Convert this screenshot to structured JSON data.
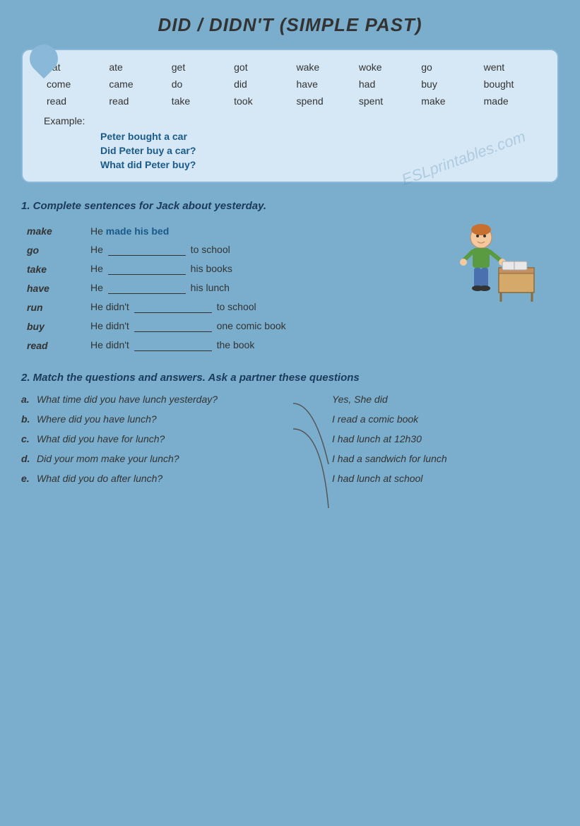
{
  "title": "DID / DIDN'T (SIMPLE PAST)",
  "vocab": {
    "pairs": [
      {
        "base": "eat",
        "past": "ate"
      },
      {
        "base": "get",
        "past": "got"
      },
      {
        "base": "wake",
        "past": "woke"
      },
      {
        "base": "go",
        "past": "went"
      },
      {
        "base": "come",
        "past": "came"
      },
      {
        "base": "do",
        "past": "did"
      },
      {
        "base": "have",
        "past": "had"
      },
      {
        "base": "buy",
        "past": "bought"
      },
      {
        "base": "read",
        "past": "read"
      },
      {
        "base": "take",
        "past": "took"
      },
      {
        "base": "spend",
        "past": "spent"
      },
      {
        "base": "make",
        "past": "made"
      }
    ],
    "example_label": "Example:",
    "examples": [
      "Peter bought a car",
      "Did Peter buy a car?",
      "What did Peter buy?"
    ]
  },
  "exercise1": {
    "heading": "1.  Complete sentences for Jack about yesterday.",
    "rows": [
      {
        "verb": "make",
        "sentence": "He made his bed",
        "is_example": true
      },
      {
        "verb": "go",
        "prefix": "He",
        "blank": true,
        "suffix": "to school"
      },
      {
        "verb": "take",
        "prefix": "He",
        "blank": true,
        "suffix": "his books"
      },
      {
        "verb": "have",
        "prefix": "He",
        "blank": true,
        "suffix": "his lunch"
      },
      {
        "verb": "run",
        "prefix": "He didn't",
        "blank": true,
        "suffix": "to school"
      },
      {
        "verb": "buy",
        "prefix": "He didn't",
        "blank": true,
        "suffix": "one comic book"
      },
      {
        "verb": "read",
        "prefix": "He didn't",
        "blank": true,
        "suffix": "the book"
      }
    ]
  },
  "exercise2": {
    "heading": "2. Match the questions and answers.  Ask a partner these questions",
    "questions": [
      {
        "label": "a.",
        "text": "What time did you have lunch yesterday?"
      },
      {
        "label": "b.",
        "text": "Where did you have lunch?"
      },
      {
        "label": "c.",
        "text": "What did you have for lunch?"
      },
      {
        "label": "d.",
        "text": "Did your mom make your lunch?"
      },
      {
        "label": "e.",
        "text": "What did you do after lunch?"
      }
    ],
    "answers": [
      "Yes, She did",
      "I read a comic book",
      "I had lunch at 12h30",
      "I had a sandwich for lunch",
      "I had lunch at school"
    ]
  },
  "watermark": "ESLprintables.com"
}
